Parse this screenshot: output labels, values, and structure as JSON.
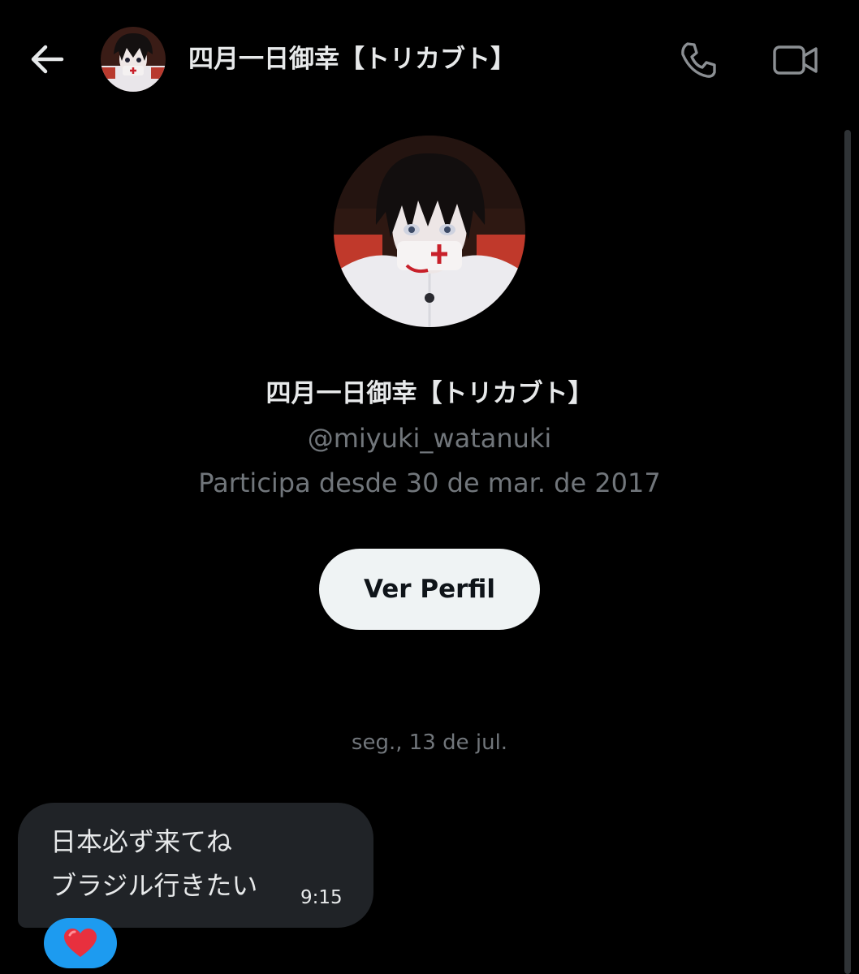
{
  "header": {
    "title": "四月一日御幸【トリカブト】",
    "back_icon": "arrow-left-icon",
    "call_icon": "phone-icon",
    "video_icon": "video-camera-icon"
  },
  "profile": {
    "name": "四月一日御幸【トリカブト】",
    "handle": "@miyuki_watanuki",
    "joined": "Participa desde 30 de mar. de 2017",
    "view_profile_label": "Ver Perfil"
  },
  "conversation": {
    "date_separator": "seg., 13 de jul.",
    "messages": [
      {
        "lines": [
          "日本必ず来てね",
          "ブラジル行きたい"
        ],
        "time": "9:15",
        "reaction": "❤️"
      }
    ]
  },
  "colors": {
    "background": "#000000",
    "text_primary": "#e7e9ea",
    "text_secondary": "#71767b",
    "bubble": "#202327",
    "button_bg": "#eff3f4",
    "reaction_bg": "#1d9bf0"
  }
}
